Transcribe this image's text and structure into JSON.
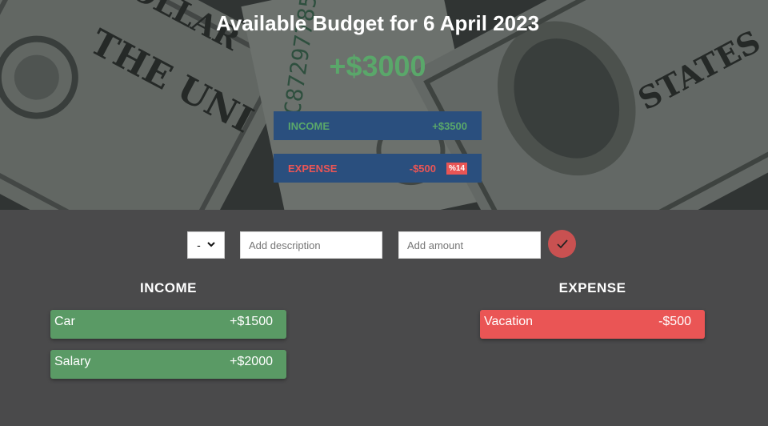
{
  "header": {
    "title": "Available Budget for 6 April 2023",
    "available_budget": "+$3000",
    "available_budget_color": "#5aa76a",
    "income_summary": {
      "label": "INCOME",
      "value": "+$3500",
      "color": "#5aa76a"
    },
    "expense_summary": {
      "label": "EXPENSE",
      "value": "-$500",
      "percentage": "%14",
      "color": "#ea5555"
    }
  },
  "form": {
    "type_select_value": "-",
    "description_placeholder": "Add description",
    "amount_placeholder": "Add amount",
    "submit_icon": "checkmark-icon"
  },
  "income": {
    "title": "INCOME",
    "items": [
      {
        "description": "Car",
        "value": "+$1500"
      },
      {
        "description": "Salary",
        "value": "+$2000"
      }
    ]
  },
  "expense": {
    "title": "EXPENSE",
    "items": [
      {
        "description": "Vacation",
        "value": "-$500"
      }
    ]
  },
  "colors": {
    "income": "#5a9a65",
    "expense": "#ea5555",
    "summary_panel": "#2a4f7e",
    "submit_button": "#c95151"
  }
}
